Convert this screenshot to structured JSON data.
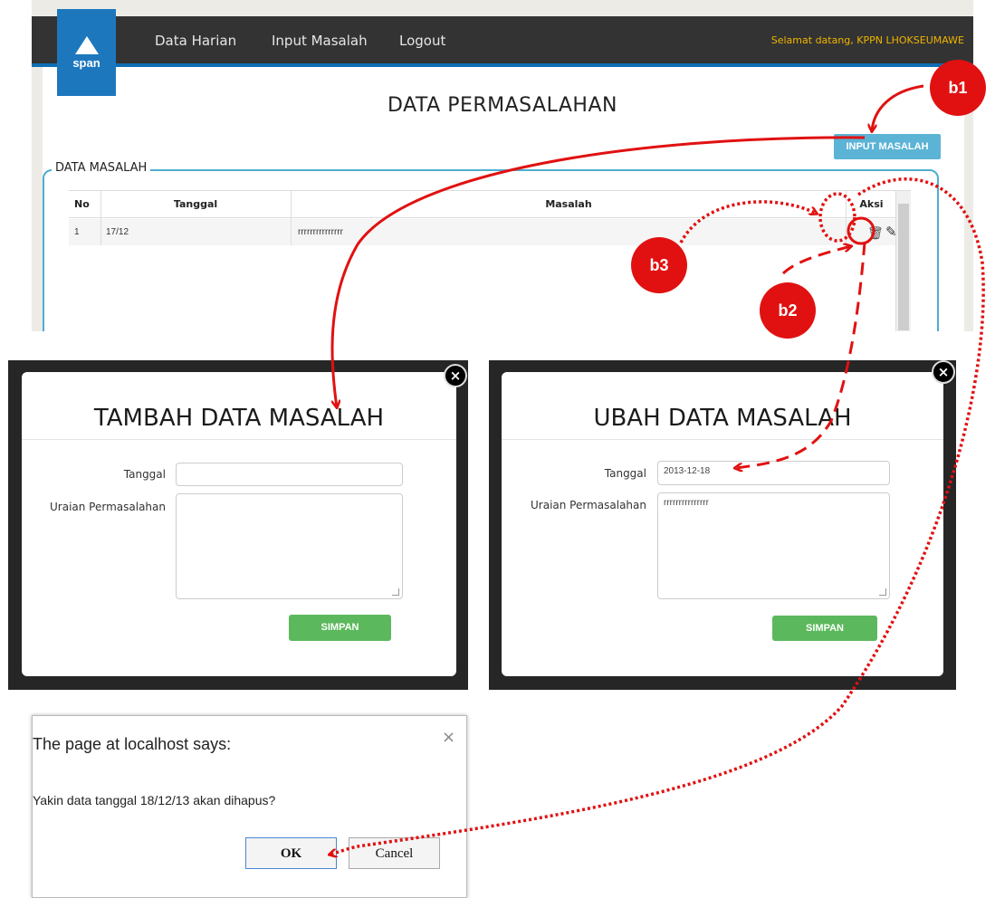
{
  "app": {
    "logo_text": "span",
    "nav": [
      "Data Harian",
      "Input Masalah",
      "Logout"
    ],
    "welcome": "Selamat datang, KPPN LHOKSEUMAWE",
    "page_title": "DATA PERMASALAHAN",
    "input_button": "INPUT MASALAH",
    "section_legend": "DATA MASALAH",
    "table": {
      "headers": [
        "No",
        "Tanggal",
        "Masalah",
        "Aksi"
      ],
      "rows": [
        {
          "no": "1",
          "tanggal": "17/12",
          "masalah": "rrrrrrrrrrrrrrr"
        }
      ]
    }
  },
  "modal_add": {
    "title": "TAMBAH DATA MASALAH",
    "label_tanggal": "Tanggal",
    "label_uraian": "Uraian Permasalahan",
    "tanggal_value": "",
    "uraian_value": "",
    "save_label": "SIMPAN"
  },
  "modal_edit": {
    "title": "UBAH DATA MASALAH",
    "label_tanggal": "Tanggal",
    "label_uraian": "Uraian Permasalahan",
    "tanggal_value": "2013-12-18",
    "uraian_value": "rrrrrrrrrrrrrrr",
    "save_label": "SIMPAN"
  },
  "alert": {
    "title": "The page at localhost says:",
    "message": "Yakin data tanggal 18/12/13 akan dihapus?",
    "ok_label": "OK",
    "cancel_label": "Cancel"
  },
  "annotations": {
    "b1": "b1",
    "b2": "b2",
    "b3": "b3",
    "color": "#e11111"
  },
  "colors": {
    "navbar": "#333333",
    "brand_blue": "#1d77bd",
    "button_info": "#5bb3d5",
    "button_success": "#5cb85c",
    "welcome_text": "#f0b400"
  }
}
